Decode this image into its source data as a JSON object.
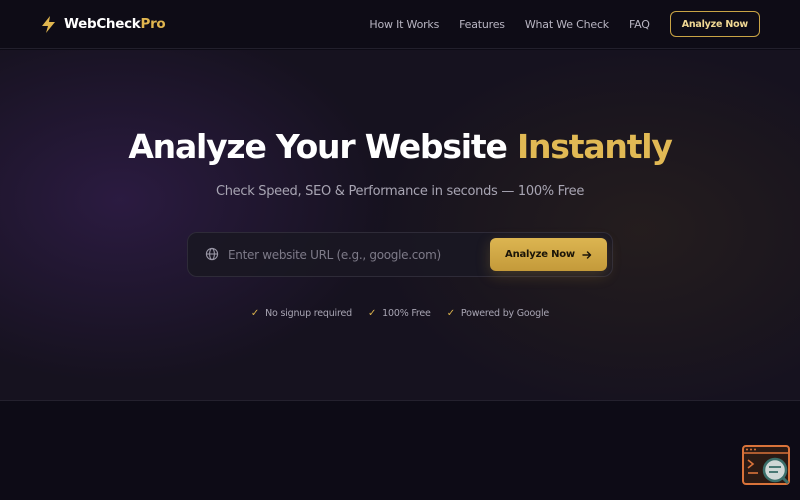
{
  "header": {
    "logo_main": "WebCheck",
    "logo_accent": "Pro",
    "nav": [
      "How It Works",
      "Features",
      "What We Check",
      "FAQ"
    ],
    "cta_label": "Analyze Now"
  },
  "hero": {
    "title_main": "Analyze Your Website ",
    "title_accent": "Instantly",
    "subtitle": "Check Speed, SEO & Performance in seconds — 100% Free",
    "search_placeholder": "Enter website URL (e.g., google.com)",
    "search_value": "",
    "button_label": "Analyze Now",
    "badges": [
      "No signup required",
      "100% Free",
      "Powered by Google"
    ]
  },
  "icons": {
    "logo": "lightning-bolt-icon",
    "search": "globe-icon",
    "button": "arrow-right-icon",
    "badge": "check-icon",
    "widget": "terminal-magnifier-icon"
  },
  "colors": {
    "accent": "#e1b954",
    "background": "#0d0b15",
    "button_gradient_start": "#dcb551",
    "button_gradient_end": "#c49a3a"
  }
}
